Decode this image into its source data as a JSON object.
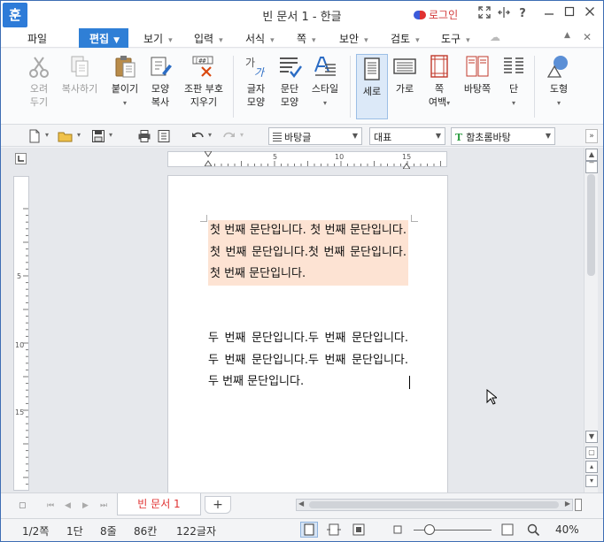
{
  "window": {
    "title": "빈 문서 1 - 한글",
    "app_icon_glyph": "훈",
    "login_label": "로그인"
  },
  "menubar": {
    "file": "파일",
    "edit": "편집",
    "items": [
      {
        "label": "보기"
      },
      {
        "label": "입력"
      },
      {
        "label": "서식"
      },
      {
        "label": "쪽"
      },
      {
        "label": "보안"
      },
      {
        "label": "검토"
      },
      {
        "label": "도구"
      }
    ]
  },
  "ribbon": {
    "cut": {
      "line1": "오려",
      "line2": "두기"
    },
    "copy": {
      "line1": "복사하기"
    },
    "paste": {
      "line1": "붙이기"
    },
    "shape_copy": {
      "line1": "모양",
      "line2": "복사"
    },
    "clear_marks": {
      "line1": "조판 부호",
      "line2": "지우기"
    },
    "char_shape": {
      "line1": "글자",
      "line2": "모양"
    },
    "para_shape": {
      "line1": "문단",
      "line2": "모양"
    },
    "style": {
      "line1": "스타일"
    },
    "vertical": {
      "line1": "세로"
    },
    "horizontal": {
      "line1": "가로"
    },
    "margins": {
      "line1": "쪽",
      "line2": "여백"
    },
    "background": {
      "line1": "바탕쪽"
    },
    "columns": {
      "line1": "단"
    },
    "shapes": {
      "line1": "도형"
    }
  },
  "toolbar2": {
    "style_combo": "바탕글",
    "lang_combo": "대표",
    "font_combo": "함초롬바탕",
    "font_glyph": "T"
  },
  "ruler": {
    "h_labels": [
      "5",
      "10",
      "15"
    ],
    "v_labels": [
      "5",
      "10",
      "15"
    ]
  },
  "document": {
    "para1": "첫 번째 문단입니다. 첫 번째 문단입니다.첫 번째 문단입니다.첫 번째 문단입니다.첫 번째 문단입니다.",
    "para2": "두 번째 문단입니다.두 번째 문단입니다.두 번째 문단입니다.두 번째 문단입니다.두 번째 문단입니다."
  },
  "tabs": {
    "doc_tab": "빈 문서 1",
    "add_tab": "+"
  },
  "status": {
    "page": "1/2쪽",
    "column": "1단",
    "line": "8줄",
    "cell": "86칸",
    "chars": "122글자",
    "zoom": "40%",
    "zoom_fraction": 0.2
  }
}
